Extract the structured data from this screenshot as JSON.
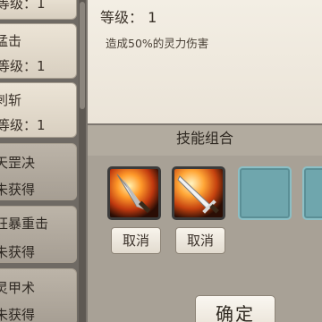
{
  "skill_list": {
    "items": [
      {
        "name": "",
        "sub": "等级：1",
        "locked": false
      },
      {
        "name": "猛击",
        "sub": "等级：1",
        "locked": false
      },
      {
        "name": "刺斩",
        "sub": "等级：1",
        "locked": false
      },
      {
        "name": "天罡决",
        "sub": "未获得",
        "locked": true
      },
      {
        "name": "狂暴重击",
        "sub": "未获得",
        "locked": true
      },
      {
        "name": "灵甲术",
        "sub": "未获得",
        "locked": true
      }
    ]
  },
  "detail": {
    "level": "等级：  1",
    "description": "造成50%的灵力伤害"
  },
  "combo": {
    "title": "技能组合",
    "slots": [
      {
        "icon": "fire-blade-icon",
        "cancel_label": "取消"
      },
      {
        "icon": "fire-sword-icon",
        "cancel_label": "取消"
      },
      {
        "icon": "empty-slot"
      },
      {
        "icon": "empty-slot"
      }
    ],
    "confirm_label": "确定"
  }
}
